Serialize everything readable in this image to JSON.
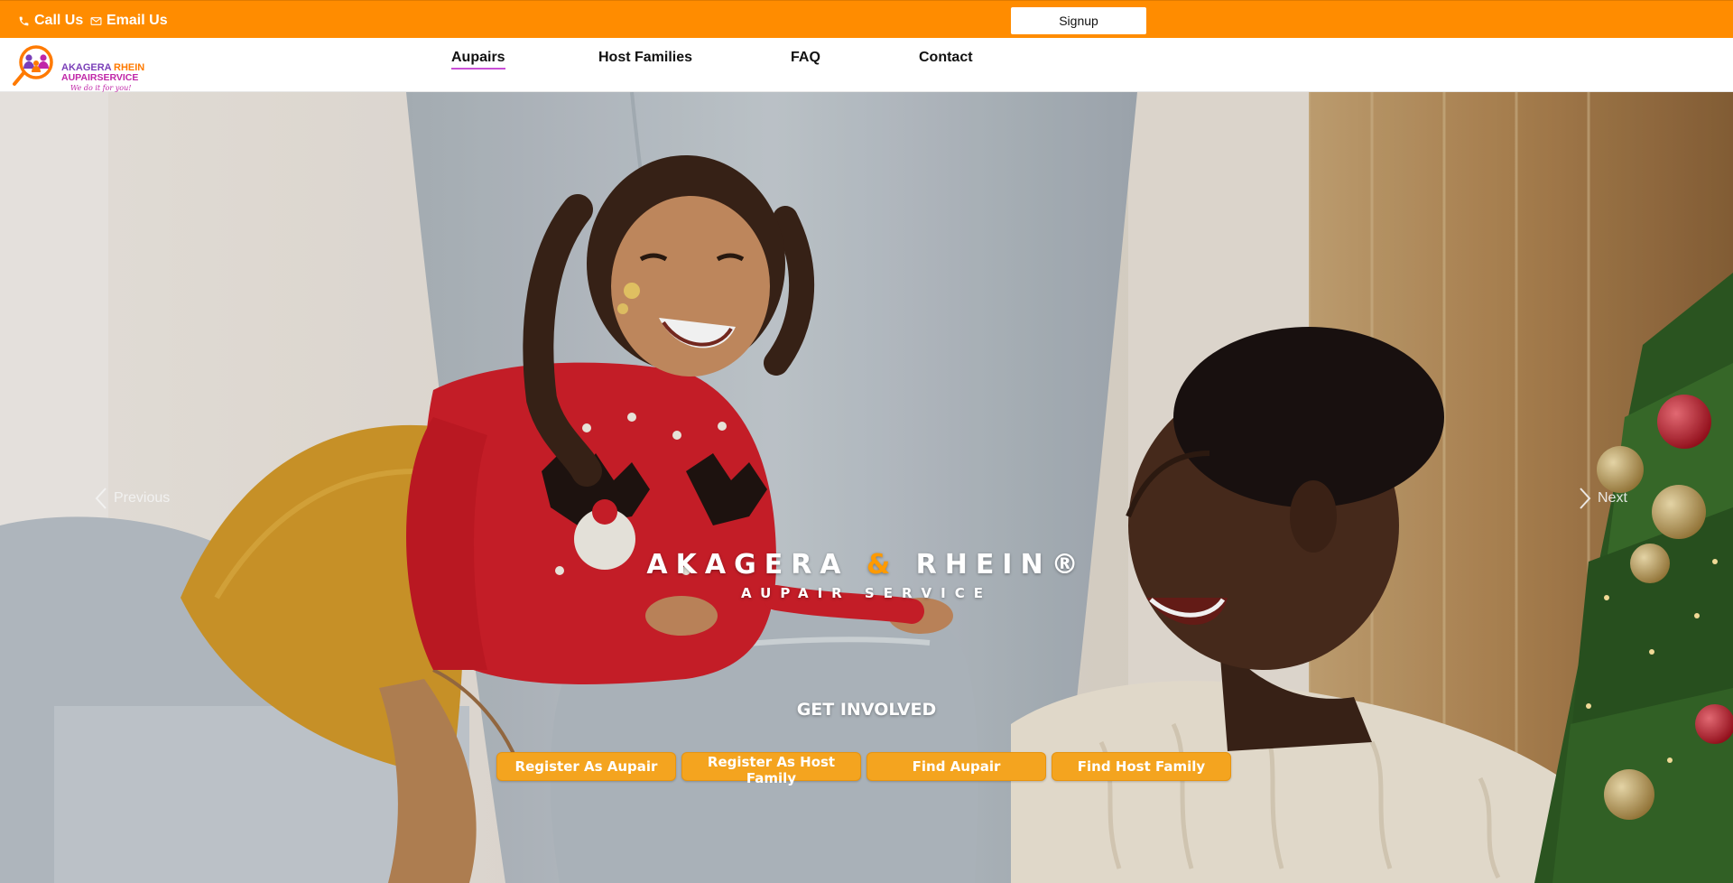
{
  "topbar": {
    "call_label": "Call Us",
    "email_label": "Email Us",
    "signup_label": "Signup",
    "background_color": "#ff8c00"
  },
  "logo": {
    "line1_a": "AKAGERA",
    "line1_b": "RHEIN",
    "line2": "AUPAIRSERVICE",
    "tagline": "We do it for you!"
  },
  "nav": {
    "items": [
      {
        "label": "Aupairs",
        "active": true
      },
      {
        "label": "Host Families",
        "active": false
      },
      {
        "label": "FAQ",
        "active": false
      },
      {
        "label": "Contact",
        "active": false
      }
    ]
  },
  "hero": {
    "prev_label": "Previous",
    "next_label": "Next",
    "brand_part1": "AKAGERA",
    "brand_amp": "&",
    "brand_part2": "RHEIN®",
    "brand_subtitle": "AUPAIR SERVICE",
    "involved_heading": "GET INVOLVED",
    "buttons": [
      {
        "label": "Register As Aupair"
      },
      {
        "label": "Register As Host Family"
      },
      {
        "label": "Find Aupair"
      },
      {
        "label": "Find Host Family"
      }
    ],
    "accent_color": "#f4a41f"
  },
  "icons": {
    "call": "phone-icon",
    "email": "envelope-icon",
    "prev": "chevron-left-icon",
    "next": "chevron-right-icon"
  }
}
